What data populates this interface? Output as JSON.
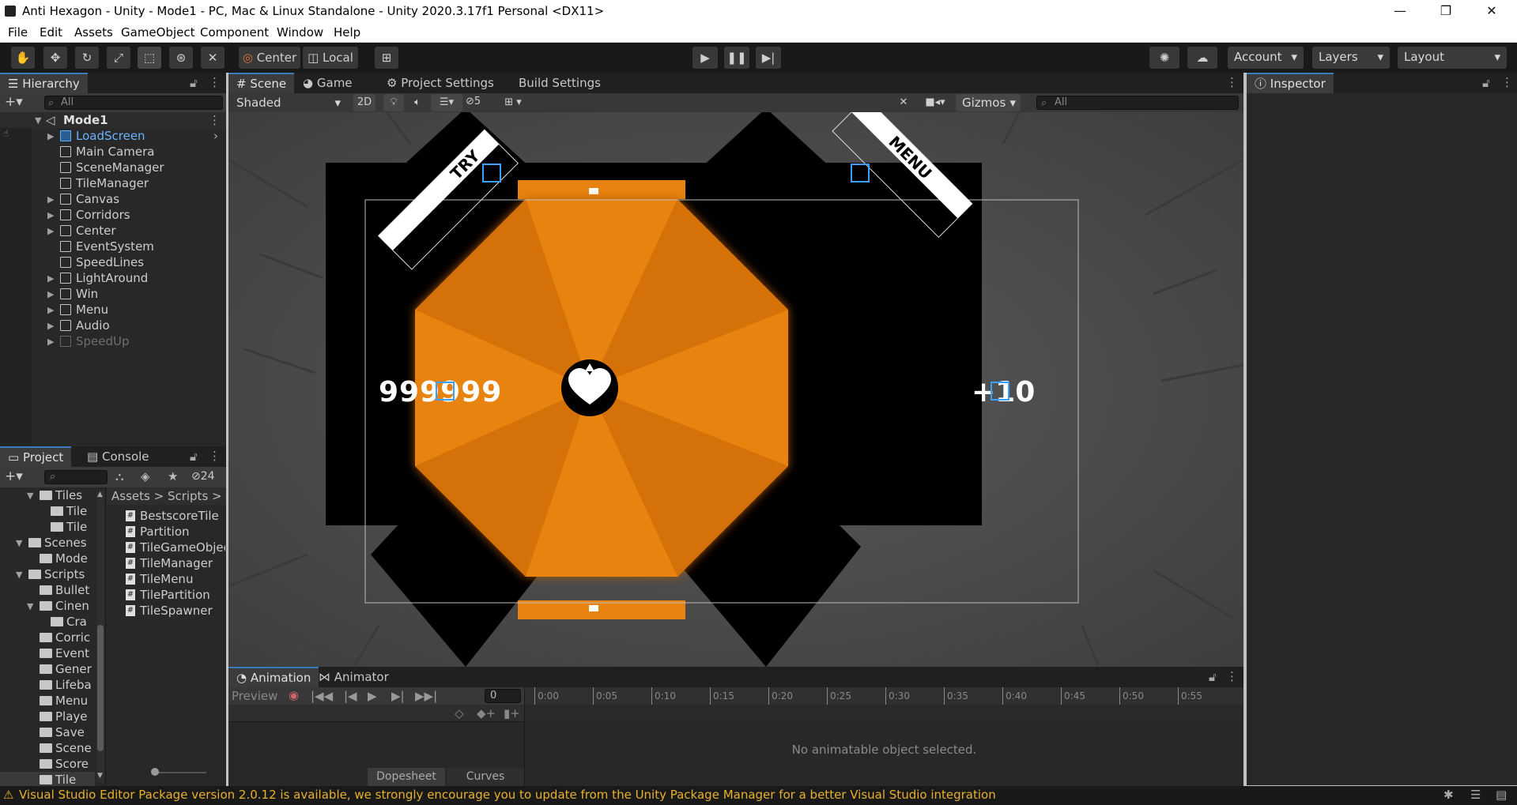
{
  "window": {
    "title": "Anti Hexagon - Unity - Mode1 - PC, Mac & Linux Standalone - Unity 2020.3.17f1 Personal <DX11>",
    "controls": [
      "—",
      "❐",
      "✕"
    ]
  },
  "menu": [
    "File",
    "Edit",
    "Assets",
    "GameObject",
    "Component",
    "Window",
    "Help"
  ],
  "toolbar": {
    "pivot": "Center",
    "space": "Local",
    "account": "Account",
    "layers": "Layers",
    "layout": "Layout"
  },
  "hierarchy": {
    "tab": "Hierarchy",
    "search_placeholder": "All",
    "scene": "Mode1",
    "items": [
      {
        "label": "LoadScreen",
        "expandable": true,
        "highlight": true
      },
      {
        "label": "Main Camera",
        "expandable": false
      },
      {
        "label": "SceneManager",
        "expandable": false
      },
      {
        "label": "TileManager",
        "expandable": false
      },
      {
        "label": "Canvas",
        "expandable": true
      },
      {
        "label": "Corridors",
        "expandable": true
      },
      {
        "label": "Center",
        "expandable": true
      },
      {
        "label": "EventSystem",
        "expandable": false
      },
      {
        "label": "SpeedLines",
        "expandable": false
      },
      {
        "label": "LightAround",
        "expandable": true
      },
      {
        "label": "Win",
        "expandable": true
      },
      {
        "label": "Menu",
        "expandable": true
      },
      {
        "label": "Audio",
        "expandable": true
      },
      {
        "label": "SpeedUp",
        "expandable": true,
        "disabled": true
      }
    ]
  },
  "project": {
    "tabs": [
      "Project",
      "Console"
    ],
    "hidden_count": "24",
    "breadcrumb": [
      "Assets",
      "Scripts"
    ],
    "tree": [
      {
        "label": "Tiles",
        "indent": 2,
        "open": true
      },
      {
        "label": "Tile",
        "indent": 3
      },
      {
        "label": "Tile",
        "indent": 3
      },
      {
        "label": "Scenes",
        "indent": 1,
        "open": true
      },
      {
        "label": "Mode",
        "indent": 2
      },
      {
        "label": "Scripts",
        "indent": 1,
        "open": true
      },
      {
        "label": "Bullet",
        "indent": 2
      },
      {
        "label": "Cinen",
        "indent": 2,
        "open": true
      },
      {
        "label": "Cra",
        "indent": 3
      },
      {
        "label": "Corric",
        "indent": 2
      },
      {
        "label": "Event",
        "indent": 2
      },
      {
        "label": "Gener",
        "indent": 2
      },
      {
        "label": "Lifeba",
        "indent": 2
      },
      {
        "label": "Menu",
        "indent": 2
      },
      {
        "label": "Playe",
        "indent": 2
      },
      {
        "label": "Save",
        "indent": 2
      },
      {
        "label": "Scene",
        "indent": 2
      },
      {
        "label": "Score",
        "indent": 2
      },
      {
        "label": "Tile",
        "indent": 2,
        "selected": true
      }
    ],
    "files": [
      "BestscoreTile",
      "Partition",
      "TileGameObjec",
      "TileManager",
      "TileMenu",
      "TilePartition",
      "TileSpawner"
    ]
  },
  "scene": {
    "tabs": [
      "Scene",
      "Game",
      "Project Settings",
      "Build Settings"
    ],
    "shading": "Shaded",
    "mode2d": "2D",
    "hidden_count": "5",
    "gizmos": "Gizmos",
    "search_placeholder": "All",
    "score_left": "999999",
    "score_right": "+10",
    "banner_left": "TRY",
    "banner_right": "MENU"
  },
  "inspector": {
    "tab": "Inspector"
  },
  "animation": {
    "tabs": [
      "Animation",
      "Animator"
    ],
    "preview": "Preview",
    "frame": "0",
    "ticks": [
      "0:00",
      "0:05",
      "0:10",
      "0:15",
      "0:20",
      "0:25",
      "0:30",
      "0:35",
      "0:40",
      "0:45",
      "0:50",
      "0:55"
    ],
    "empty_message": "No animatable object selected.",
    "bottom_tabs": [
      "Dopesheet",
      "Curves"
    ]
  },
  "status": {
    "message": "Visual Studio Editor Package version 2.0.12 is available, we strongly encourage you to update from the Unity Package Manager for a better Visual Studio integration"
  },
  "colors": {
    "orange": "#e8830f",
    "accent": "#3a79bb",
    "warning": "#e8b12c"
  }
}
